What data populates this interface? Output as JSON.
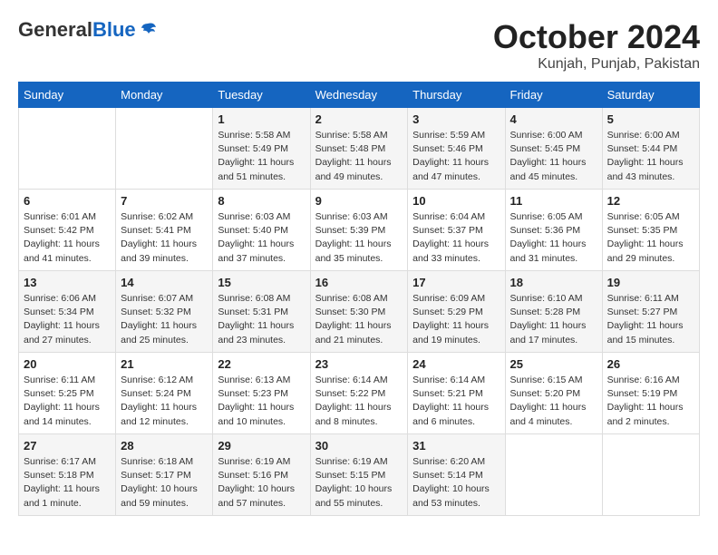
{
  "header": {
    "logo_general": "General",
    "logo_blue": "Blue",
    "month_title": "October 2024",
    "location": "Kunjah, Punjab, Pakistan"
  },
  "days_of_week": [
    "Sunday",
    "Monday",
    "Tuesday",
    "Wednesday",
    "Thursday",
    "Friday",
    "Saturday"
  ],
  "weeks": [
    [
      {
        "day": "",
        "info": ""
      },
      {
        "day": "",
        "info": ""
      },
      {
        "day": "1",
        "info": "Sunrise: 5:58 AM\nSunset: 5:49 PM\nDaylight: 11 hours and 51 minutes."
      },
      {
        "day": "2",
        "info": "Sunrise: 5:58 AM\nSunset: 5:48 PM\nDaylight: 11 hours and 49 minutes."
      },
      {
        "day": "3",
        "info": "Sunrise: 5:59 AM\nSunset: 5:46 PM\nDaylight: 11 hours and 47 minutes."
      },
      {
        "day": "4",
        "info": "Sunrise: 6:00 AM\nSunset: 5:45 PM\nDaylight: 11 hours and 45 minutes."
      },
      {
        "day": "5",
        "info": "Sunrise: 6:00 AM\nSunset: 5:44 PM\nDaylight: 11 hours and 43 minutes."
      }
    ],
    [
      {
        "day": "6",
        "info": "Sunrise: 6:01 AM\nSunset: 5:42 PM\nDaylight: 11 hours and 41 minutes."
      },
      {
        "day": "7",
        "info": "Sunrise: 6:02 AM\nSunset: 5:41 PM\nDaylight: 11 hours and 39 minutes."
      },
      {
        "day": "8",
        "info": "Sunrise: 6:03 AM\nSunset: 5:40 PM\nDaylight: 11 hours and 37 minutes."
      },
      {
        "day": "9",
        "info": "Sunrise: 6:03 AM\nSunset: 5:39 PM\nDaylight: 11 hours and 35 minutes."
      },
      {
        "day": "10",
        "info": "Sunrise: 6:04 AM\nSunset: 5:37 PM\nDaylight: 11 hours and 33 minutes."
      },
      {
        "day": "11",
        "info": "Sunrise: 6:05 AM\nSunset: 5:36 PM\nDaylight: 11 hours and 31 minutes."
      },
      {
        "day": "12",
        "info": "Sunrise: 6:05 AM\nSunset: 5:35 PM\nDaylight: 11 hours and 29 minutes."
      }
    ],
    [
      {
        "day": "13",
        "info": "Sunrise: 6:06 AM\nSunset: 5:34 PM\nDaylight: 11 hours and 27 minutes."
      },
      {
        "day": "14",
        "info": "Sunrise: 6:07 AM\nSunset: 5:32 PM\nDaylight: 11 hours and 25 minutes."
      },
      {
        "day": "15",
        "info": "Sunrise: 6:08 AM\nSunset: 5:31 PM\nDaylight: 11 hours and 23 minutes."
      },
      {
        "day": "16",
        "info": "Sunrise: 6:08 AM\nSunset: 5:30 PM\nDaylight: 11 hours and 21 minutes."
      },
      {
        "day": "17",
        "info": "Sunrise: 6:09 AM\nSunset: 5:29 PM\nDaylight: 11 hours and 19 minutes."
      },
      {
        "day": "18",
        "info": "Sunrise: 6:10 AM\nSunset: 5:28 PM\nDaylight: 11 hours and 17 minutes."
      },
      {
        "day": "19",
        "info": "Sunrise: 6:11 AM\nSunset: 5:27 PM\nDaylight: 11 hours and 15 minutes."
      }
    ],
    [
      {
        "day": "20",
        "info": "Sunrise: 6:11 AM\nSunset: 5:25 PM\nDaylight: 11 hours and 14 minutes."
      },
      {
        "day": "21",
        "info": "Sunrise: 6:12 AM\nSunset: 5:24 PM\nDaylight: 11 hours and 12 minutes."
      },
      {
        "day": "22",
        "info": "Sunrise: 6:13 AM\nSunset: 5:23 PM\nDaylight: 11 hours and 10 minutes."
      },
      {
        "day": "23",
        "info": "Sunrise: 6:14 AM\nSunset: 5:22 PM\nDaylight: 11 hours and 8 minutes."
      },
      {
        "day": "24",
        "info": "Sunrise: 6:14 AM\nSunset: 5:21 PM\nDaylight: 11 hours and 6 minutes."
      },
      {
        "day": "25",
        "info": "Sunrise: 6:15 AM\nSunset: 5:20 PM\nDaylight: 11 hours and 4 minutes."
      },
      {
        "day": "26",
        "info": "Sunrise: 6:16 AM\nSunset: 5:19 PM\nDaylight: 11 hours and 2 minutes."
      }
    ],
    [
      {
        "day": "27",
        "info": "Sunrise: 6:17 AM\nSunset: 5:18 PM\nDaylight: 11 hours and 1 minute."
      },
      {
        "day": "28",
        "info": "Sunrise: 6:18 AM\nSunset: 5:17 PM\nDaylight: 10 hours and 59 minutes."
      },
      {
        "day": "29",
        "info": "Sunrise: 6:19 AM\nSunset: 5:16 PM\nDaylight: 10 hours and 57 minutes."
      },
      {
        "day": "30",
        "info": "Sunrise: 6:19 AM\nSunset: 5:15 PM\nDaylight: 10 hours and 55 minutes."
      },
      {
        "day": "31",
        "info": "Sunrise: 6:20 AM\nSunset: 5:14 PM\nDaylight: 10 hours and 53 minutes."
      },
      {
        "day": "",
        "info": ""
      },
      {
        "day": "",
        "info": ""
      }
    ]
  ]
}
